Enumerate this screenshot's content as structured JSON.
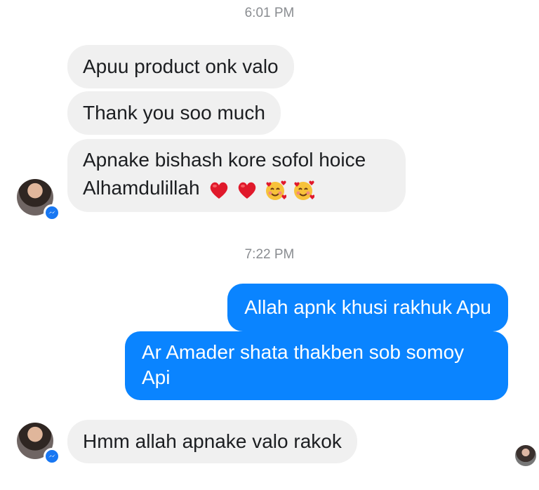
{
  "timestamps": [
    "6:01 PM",
    "7:22 PM"
  ],
  "incoming": {
    "msg1": "Apuu product  onk valo",
    "msg2": "Thank you soo much",
    "msg3_line1": "Apnake bishash kore sofol hoice",
    "msg3_line2": "Alhamdulillah",
    "msg3_emojis": [
      "red-heart",
      "red-heart",
      "smiling-face-with-hearts",
      "smiling-face-with-hearts"
    ],
    "msg4": "Hmm allah apnake valo rakok"
  },
  "outgoing": {
    "msg1": "Allah apnk khusi rakhuk Apu",
    "msg2_line1": "Ar Amader shata thakben sob somoy",
    "msg2_line2": "Api"
  },
  "colors": {
    "outgoing_bubble": "#0a84ff",
    "incoming_bubble": "#f0f0f0",
    "timestamp": "#8a8d91",
    "messenger_badge": "#1877f2"
  }
}
